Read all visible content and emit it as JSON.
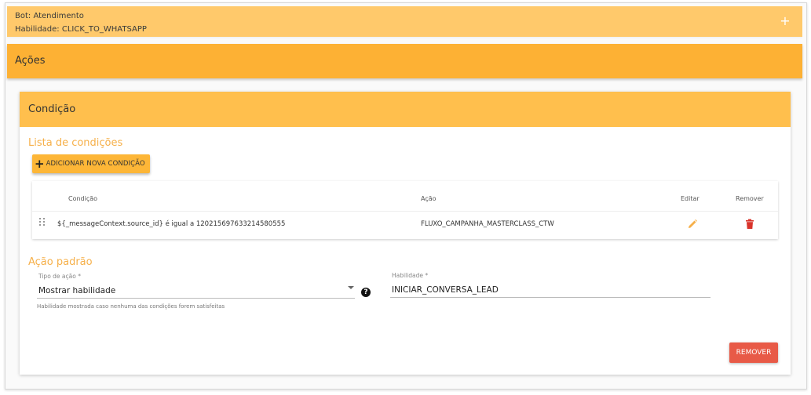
{
  "bot": {
    "bot_line": "Bot: Atendimento",
    "skill_line": "Habilidade: CLICK_TO_WHATSAPP"
  },
  "acoes": {
    "title": "Ações"
  },
  "condicao": {
    "title": "Condição",
    "list_title": "Lista de condições",
    "add_button_label": "ADICIONAR NOVA CONDIÇÃO",
    "table": {
      "headers": {
        "condicao": "Condição",
        "acao": "Ação",
        "editar": "Editar",
        "remover": "Remover"
      },
      "rows": [
        {
          "condicao": "${_messageContext.source_id} é igual a 120215697633214580555",
          "acao": "FLUXO_CAMPANHA_MASTERCLASS_CTW"
        }
      ]
    },
    "default_action": {
      "title": "Ação padrão",
      "tipo_label": "Tipo de ação",
      "tipo_value": "Mostrar habilidade",
      "habilidade_label": "Habilidade",
      "habilidade_value": "INICIAR_CONVERSA_LEAD",
      "required_mark": "*",
      "helper_text": "Habilidade mostrada caso nenhuma das condições forem satisfeitas"
    },
    "remove_button_label": "REMOVER"
  },
  "icons": {
    "expand": "plus-icon",
    "add": "plus-icon",
    "drag": "drag-handle-icon",
    "edit": "pencil-icon",
    "delete": "trash-icon",
    "dropdown": "caret-down-icon",
    "help": "question-circle-icon"
  },
  "colors": {
    "bot_header": "#ffc96b",
    "acoes_header": "#fdb134",
    "card_header": "#ffbf4d",
    "section_title": "#f6b04a",
    "edit_icon": "#f6b04a",
    "delete_icon": "#d9342b",
    "remove_button": "#e85a47"
  }
}
